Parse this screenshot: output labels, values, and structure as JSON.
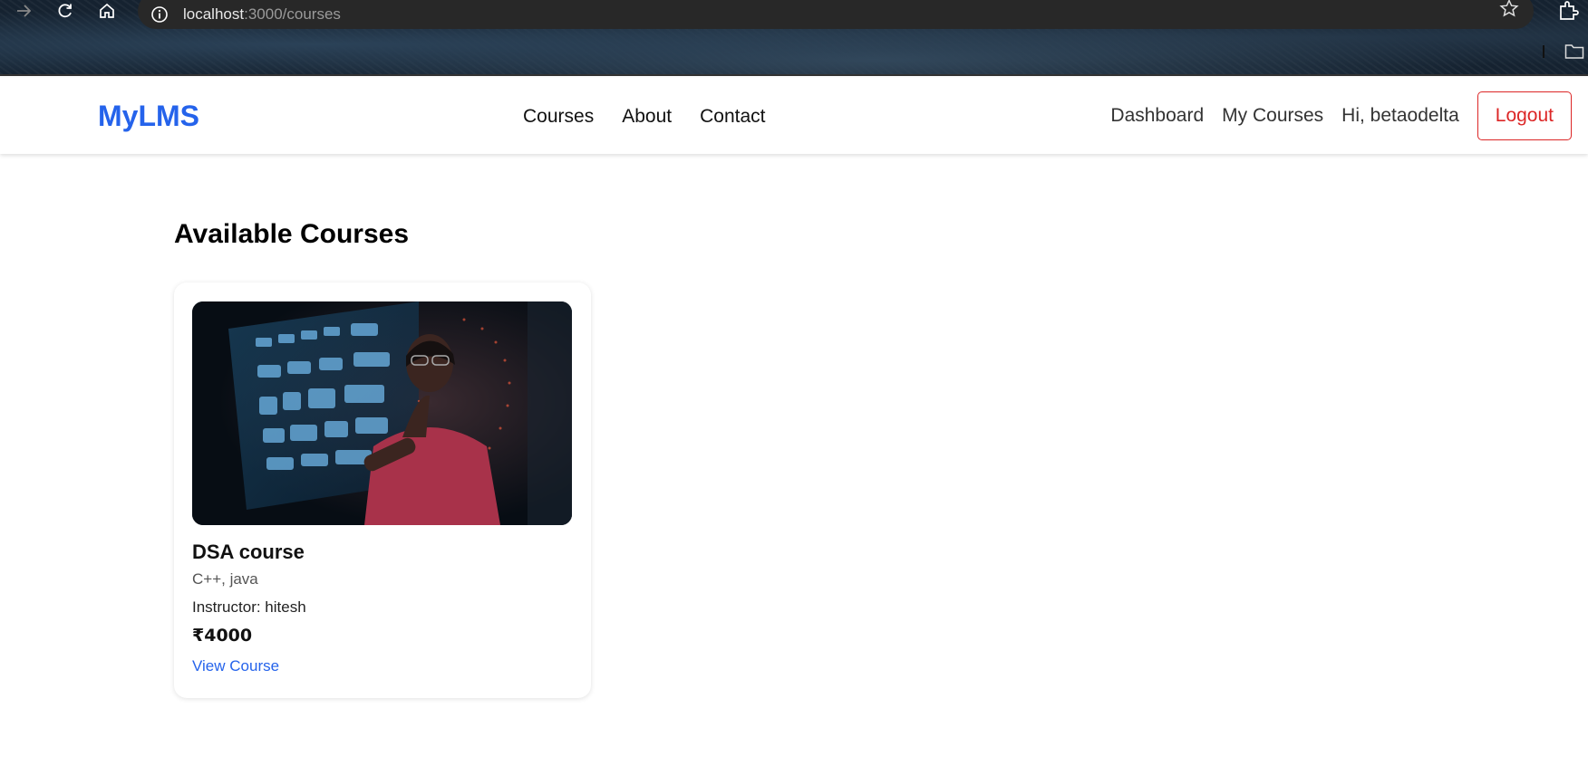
{
  "browser": {
    "url_host": "localhost",
    "url_rest": ":3000/courses",
    "icons": [
      "back-icon",
      "reload-icon",
      "home-icon",
      "info-icon",
      "star-icon",
      "extensions-icon",
      "folder-icon"
    ]
  },
  "header": {
    "logo": "MyLMS",
    "nav": {
      "courses": "Courses",
      "about": "About",
      "contact": "Contact"
    },
    "user_nav": {
      "dashboard": "Dashboard",
      "my_courses": "My Courses",
      "greeting": "Hi, betaodelta"
    },
    "logout_label": "Logout"
  },
  "main": {
    "title": "Available Courses",
    "courses": [
      {
        "title": "DSA course",
        "subtitle": "C++, java",
        "instructor": "Instructor: hitesh",
        "price": "₹4000",
        "link_label": "View Course"
      }
    ]
  },
  "colors": {
    "brand": "#2563eb",
    "logout": "#dc2626",
    "link": "#2563eb"
  }
}
